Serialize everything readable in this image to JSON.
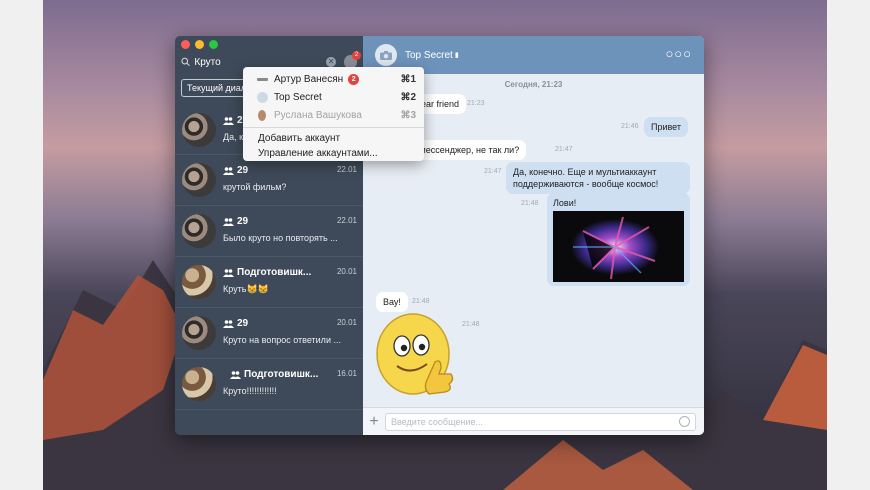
{
  "sidebar": {
    "search_value": "Круто",
    "account_badge": "2",
    "folder_button": "Текущий диалог",
    "dialogs": [
      {
        "name": "29",
        "time": "",
        "message": "Да, конечно..."
      },
      {
        "name": "29",
        "time": "22.01",
        "message": "крутой фильм?"
      },
      {
        "name": "29",
        "time": "22.01",
        "message": "Было круто но повторять ..."
      },
      {
        "name": "Подготовишк...",
        "time": "20.01",
        "message": "Круть😸😸"
      },
      {
        "name": "29",
        "time": "20.01",
        "message": "Круто на вопрос ответили ..."
      },
      {
        "name": "Подготовишк...",
        "time": "16.01",
        "message": "Круто!!!!!!!!!!!!"
      }
    ]
  },
  "account_menu": {
    "accounts": [
      {
        "label": "Артур Ванесян",
        "badge": "2",
        "shortcut": "⌘1"
      },
      {
        "label": "Top Secret",
        "shortcut": "⌘2"
      },
      {
        "label": "Руслана Вашукова",
        "shortcut": "⌘3"
      }
    ],
    "add_account": "Добавить аккаунт",
    "manage_accounts": "Управление аккаунтами..."
  },
  "chat": {
    "title": "Top Secret",
    "date_separator": "Сегодня, 21:23",
    "messages": [
      {
        "text": "dear friend",
        "time": "21:23"
      },
      {
        "text": "Привет",
        "time": "21:46"
      },
      {
        "text": "й мессенджер, не так ли?",
        "time": "21:47"
      },
      {
        "text": "Да, конечно. Еще и мультиаккаунт поддерживаются - вообще космос!",
        "time": "21:47"
      },
      {
        "text": "Лови!",
        "time": "21:48"
      },
      {
        "text": "Вау!",
        "time": "21:48"
      },
      {
        "text": "",
        "time": "21:48"
      }
    ],
    "composer_placeholder": "Введите сообщение..."
  },
  "colors": {
    "sidebar": "#3e4a59",
    "header": "#6e93bb",
    "chat_bg": "#e7edf4",
    "out_bubble": "#cfdff2",
    "badge": "#e6423e"
  }
}
